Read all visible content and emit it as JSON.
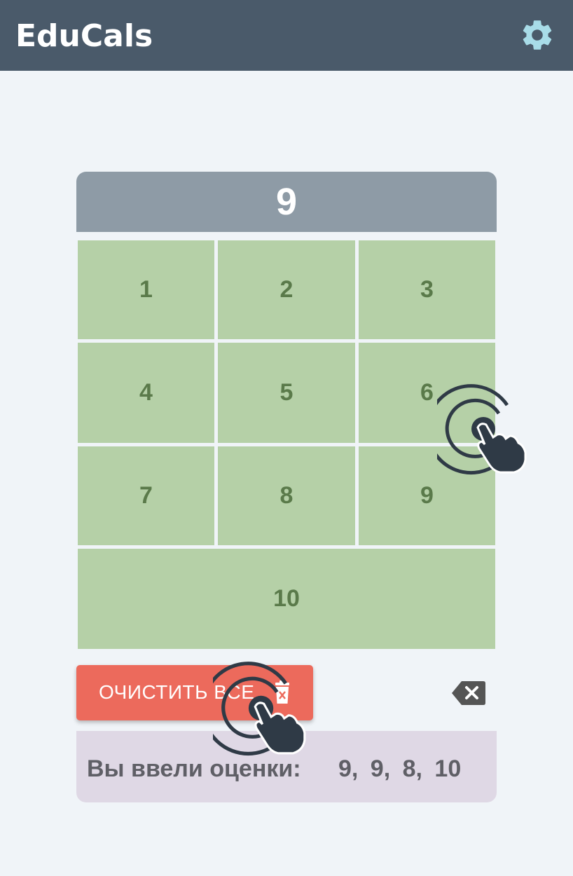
{
  "header": {
    "logo_text": "EduCals",
    "settings_icon": "gear-icon",
    "background_color": "#4a5a6a",
    "gear_color": "#a8dce8"
  },
  "display": {
    "value": "9"
  },
  "keypad": {
    "keys": [
      "1",
      "2",
      "3",
      "4",
      "5",
      "6",
      "7",
      "8",
      "9",
      "10"
    ],
    "key_color": "#b5d0a7",
    "text_color": "#5a7a4a"
  },
  "actions": {
    "clear_all_label": "ОЧИСТИТЬ ВСЕ",
    "clear_icon": "trash-icon",
    "backspace_icon": "backspace-icon",
    "clear_color": "#ec6a5c"
  },
  "result": {
    "label": "Вы ввели оценки:",
    "values_text": "9, 9, 8, 10"
  },
  "overlay": {
    "tap_indicator_icon": "tap-hand-icon"
  }
}
